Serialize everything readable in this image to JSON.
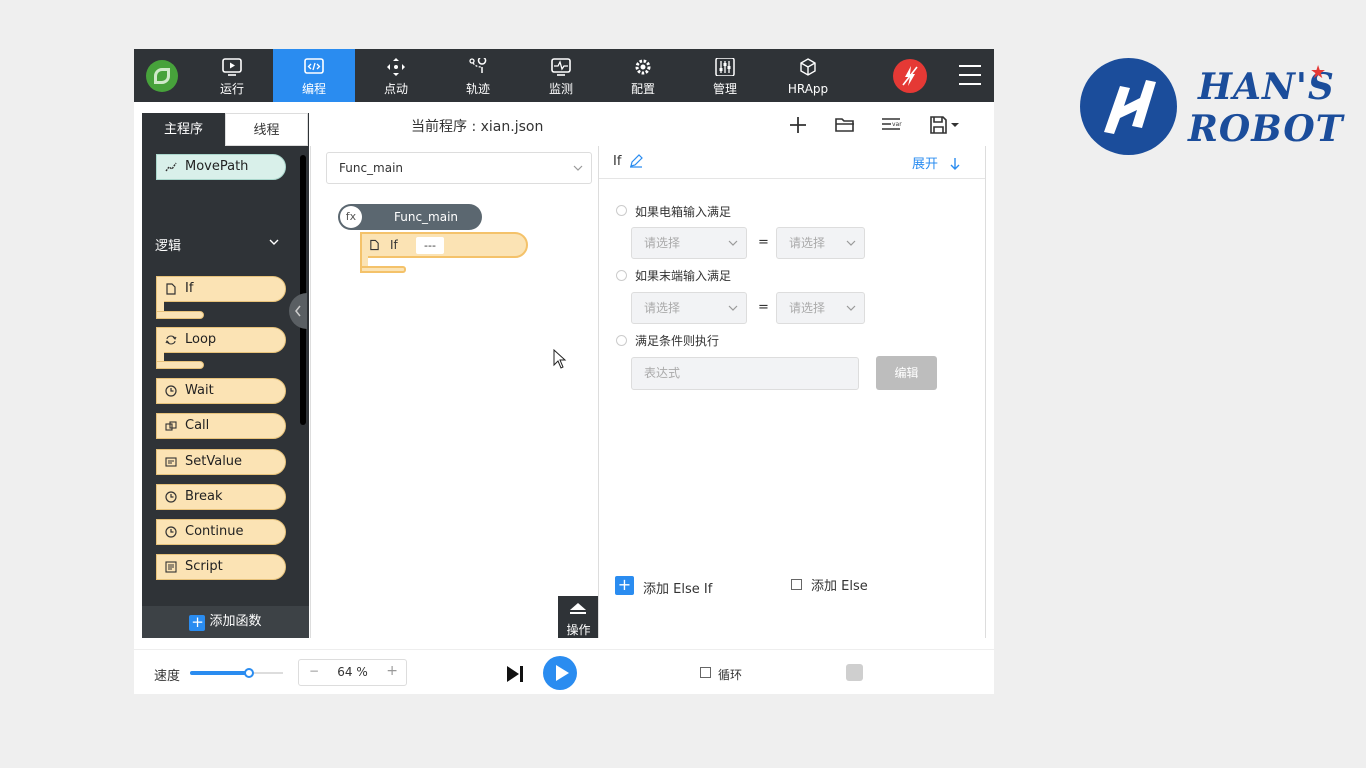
{
  "nav": {
    "items": [
      {
        "label": "运行",
        "icon": "play-screen-icon"
      },
      {
        "label": "编程",
        "icon": "code-icon"
      },
      {
        "label": "点动",
        "icon": "move-arrows-icon"
      },
      {
        "label": "轨迹",
        "icon": "trajectory-icon"
      },
      {
        "label": "监测",
        "icon": "monitor-icon"
      },
      {
        "label": "配置",
        "icon": "gear-icon"
      },
      {
        "label": "管理",
        "icon": "sliders-icon"
      },
      {
        "label": "HRApp",
        "icon": "cube-icon"
      }
    ],
    "active": "编程",
    "accent": "#2a8cf0",
    "bar_color": "#2f3337"
  },
  "tabs": {
    "main": "主程序",
    "thread": "线程"
  },
  "header": {
    "current_program": "当前程序 : xian.json"
  },
  "palette": {
    "top_block": "MovePath",
    "section_title": "逻辑",
    "blocks": [
      "If",
      "Loop",
      "Wait",
      "Call",
      "SetValue",
      "Break",
      "Continue",
      "Script"
    ],
    "add_function": "添加函数"
  },
  "editor": {
    "function_select": "Func_main",
    "func_block": "Func_main",
    "fx": "fx",
    "if_block": "If",
    "if_condition": "---",
    "operate": "操作"
  },
  "props": {
    "title": "If",
    "expand": "展开",
    "cond1": "如果电箱输入满足",
    "cond2": "如果末端输入满足",
    "cond3": "满足条件则执行",
    "placeholder_select": "请选择",
    "equals": "=",
    "expr_placeholder": "表达式",
    "edit": "编辑",
    "add_else_if": "添加 Else If",
    "add_else": "添加 Else"
  },
  "bottom": {
    "speed_label": "速度",
    "speed_percent": 64,
    "zoom": "64 %",
    "zoom_minus": "−",
    "zoom_plus": "+",
    "loop_label": "循环"
  },
  "brand": {
    "line1": "HAN",
    "star": "★",
    "line1b": "S",
    "line2": "ROBOT"
  }
}
